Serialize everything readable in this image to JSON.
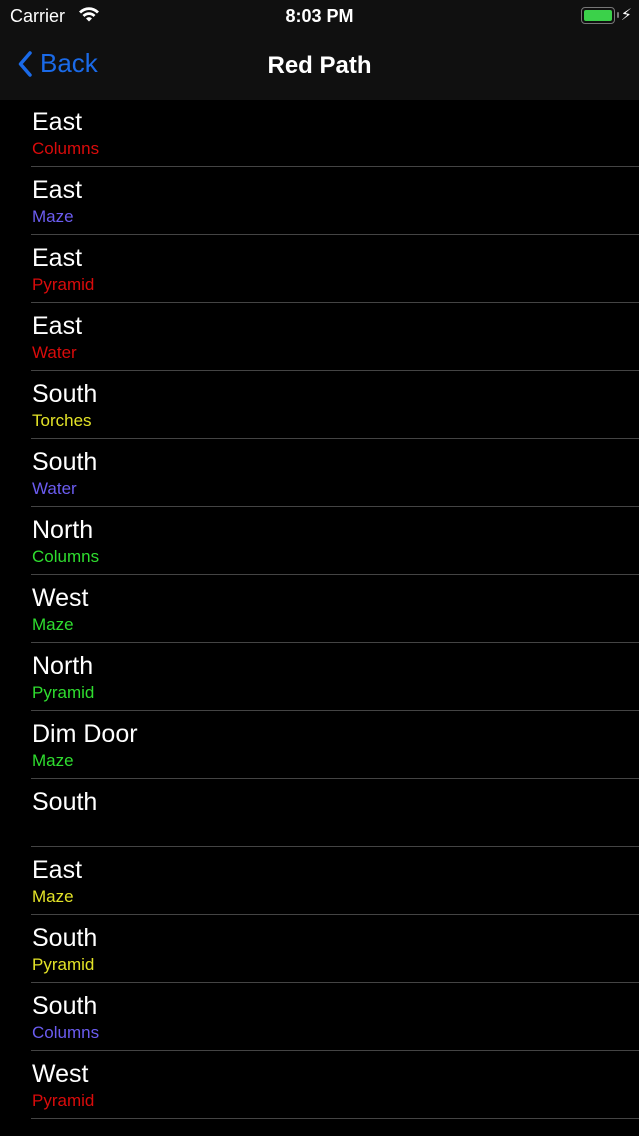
{
  "status_bar": {
    "carrier": "Carrier",
    "time": "8:03 PM",
    "battery_level": 1.0,
    "charging": true
  },
  "nav": {
    "back_label": "Back",
    "title": "Red Path"
  },
  "colors": {
    "red": "#d90b0b",
    "blue": "#6b5cf0",
    "yellow": "#e3e327",
    "green": "#2fdd2f",
    "accent": "#1a6ae8"
  },
  "items": [
    {
      "title": "East",
      "subtitle": "Columns",
      "color": "red"
    },
    {
      "title": "East",
      "subtitle": "Maze",
      "color": "blue"
    },
    {
      "title": "East",
      "subtitle": "Pyramid",
      "color": "red"
    },
    {
      "title": "East",
      "subtitle": "Water",
      "color": "red"
    },
    {
      "title": "South",
      "subtitle": "Torches",
      "color": "yellow"
    },
    {
      "title": "South",
      "subtitle": "Water",
      "color": "blue"
    },
    {
      "title": "North",
      "subtitle": "Columns",
      "color": "green"
    },
    {
      "title": "West",
      "subtitle": "Maze",
      "color": "green"
    },
    {
      "title": "North",
      "subtitle": "Pyramid",
      "color": "green"
    },
    {
      "title": "Dim Door",
      "subtitle": "Maze",
      "color": "green"
    },
    {
      "title": "South",
      "subtitle": "",
      "color": "green"
    },
    {
      "title": "East",
      "subtitle": "Maze",
      "color": "yellow"
    },
    {
      "title": "South",
      "subtitle": "Pyramid",
      "color": "yellow"
    },
    {
      "title": "South",
      "subtitle": "Columns",
      "color": "blue"
    },
    {
      "title": "West",
      "subtitle": "Pyramid",
      "color": "red"
    }
  ]
}
